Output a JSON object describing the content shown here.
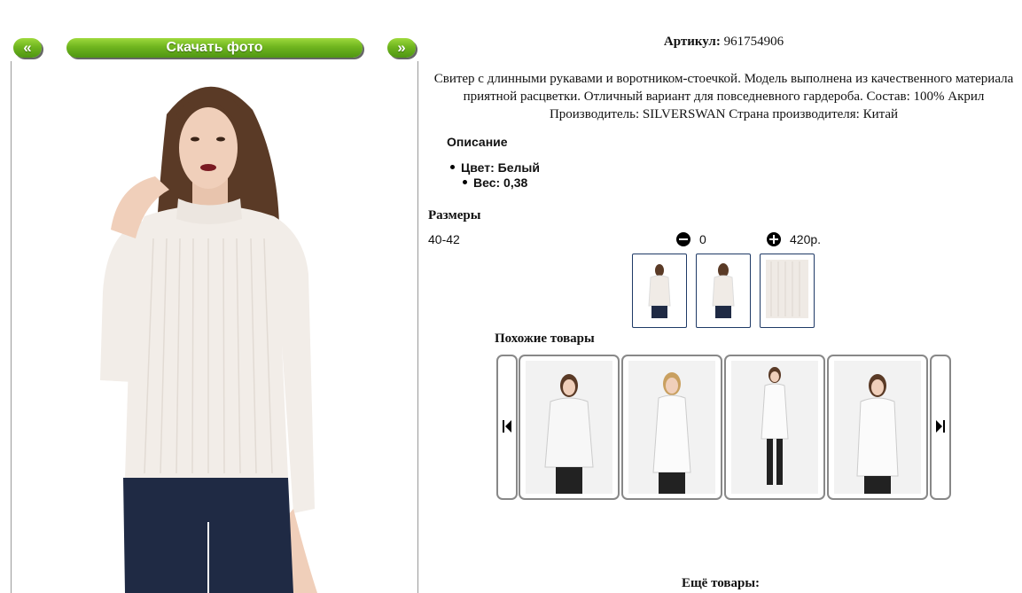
{
  "top_bar": {
    "prev_label": "«",
    "download_label": "Скачать фото",
    "next_label": "»"
  },
  "product": {
    "sku_label": "Артикул:",
    "sku_value": "961754906",
    "description": "Свитер с длинными рукавами и воротником-стоечкой. Модель выполнена из качественного материала приятной расцветки. Отличный вариант для повседневного гардероба. Состав: 100% Акрил Производитель: SILVERSWAN Страна производителя: Китай",
    "section_title": "Описание",
    "props": [
      {
        "text": "Цвет: Белый"
      },
      {
        "text": "Вес: 0,38"
      }
    ]
  },
  "sizes": {
    "title": "Размеры",
    "rows": [
      {
        "size": "40-42",
        "qty": "0",
        "price": "420р."
      }
    ]
  },
  "similar": {
    "title": "Похожие товары"
  },
  "more": {
    "title": "Ещё товары:"
  },
  "icons": {
    "minus": "minus-circle-icon",
    "plus": "plus-circle-icon",
    "left_end": "skip-previous-icon",
    "right_end": "skip-next-icon"
  },
  "colors": {
    "button_green": "#6fb51f",
    "thumb_border": "#1f3a66",
    "card_border": "#888888"
  }
}
